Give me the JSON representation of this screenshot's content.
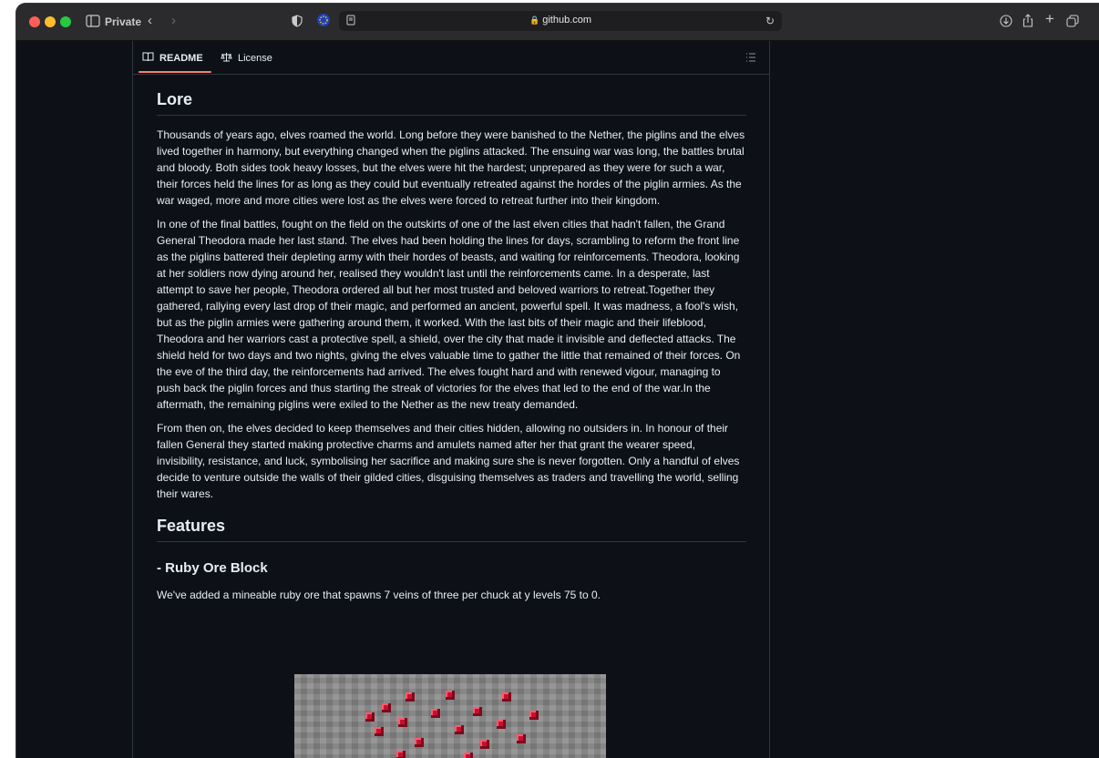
{
  "browser": {
    "private_label": "Private",
    "url": "github.com"
  },
  "tabs": [
    {
      "label": "README",
      "icon": "book-icon",
      "active": true
    },
    {
      "label": "License",
      "icon": "scale-icon",
      "active": false
    }
  ],
  "readme": {
    "lore_heading": "Lore",
    "lore_paragraphs": [
      "Thousands of years ago, elves roamed the world. Long before they were banished to the Nether, the piglins and the elves lived together in harmony, but everything changed when the piglins attacked. The ensuing war was long, the battles brutal and bloody. Both sides took heavy losses, but the elves were hit the hardest; unprepared as they were for such a war, their forces held the lines for as long as they could but eventually retreated against the hordes of the piglin armies. As the war waged, more and more cities were lost as the elves were forced to retreat further into their kingdom.",
      "In one of the final battles, fought on the field on the outskirts of one of the last elven cities that hadn't fallen, the Grand General Theodora made her last stand. The elves had been holding the lines for days, scrambling to reform the front line as the piglins battered their depleting army with their hordes of beasts, and waiting for reinforcements. Theodora, looking at her soldiers now dying around her, realised they wouldn't last until the reinforcements came. In a desperate, last attempt to save her people, Theodora ordered all but her most trusted and beloved warriors to retreat.Together they gathered, rallying every last drop of their magic, and performed an ancient, powerful spell. It was madness, a fool's wish, but as the piglin armies were gathering around them, it worked. With the last bits of their magic and their lifeblood, Theodora and her warriors cast a protective spell, a shield, over the city that made it invisible and deflected attacks. The shield held for two days and two nights, giving the elves valuable time to gather the little that remained of their forces. On the eve of the third day, the reinforcements had arrived. The elves fought hard and with renewed vigour, managing to push back the piglin forces and thus starting the streak of victories for the elves that led to the end of the war.In the aftermath, the remaining piglins were exiled to the Nether as the new treaty demanded.",
      "From then on, the elves decided to keep themselves and their cities hidden, allowing no outsiders in. In honour of their fallen General they started making protective charms and amulets named after her that grant the wearer speed, invisibility, resistance, and luck, symbolising her sacrifice and making sure she is never forgotten. Only a handful of elves decide to venture outside the walls of their gilded cities, disguising themselves as traders and travelling the world, selling their wares."
    ],
    "features_heading": "Features",
    "ruby_heading": "- Ruby Ore Block",
    "ruby_text": "We've added a mineable ruby ore that spawns 7 veins of three per chuck at y levels 75 to 0."
  }
}
